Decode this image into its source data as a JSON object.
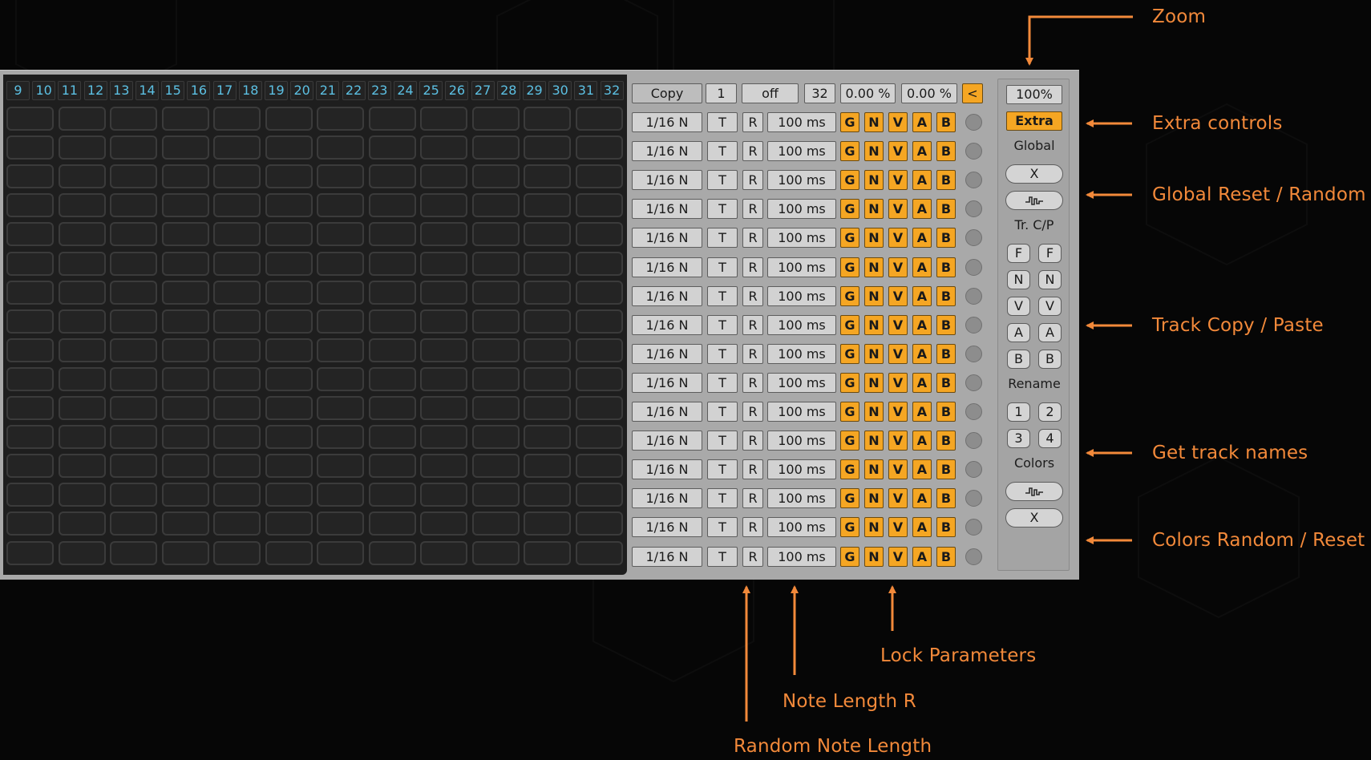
{
  "step_numbers": [
    "9",
    "10",
    "11",
    "12",
    "13",
    "14",
    "15",
    "16",
    "17",
    "18",
    "19",
    "20",
    "21",
    "22",
    "23",
    "24",
    "25",
    "26",
    "27",
    "28",
    "29",
    "30",
    "31",
    "32"
  ],
  "header": {
    "copy_label": "Copy",
    "value_1": "1",
    "off_label": "off",
    "value_32": "32",
    "percent_a": "0.00 %",
    "percent_b": "0.00 %",
    "collapse_label": "<"
  },
  "tracks": [
    {
      "note_length": "1/16 N",
      "t": "T",
      "r": "R",
      "time": "100 ms",
      "locks": [
        "G",
        "N",
        "V",
        "A",
        "B"
      ]
    },
    {
      "note_length": "1/16 N",
      "t": "T",
      "r": "R",
      "time": "100 ms",
      "locks": [
        "G",
        "N",
        "V",
        "A",
        "B"
      ]
    },
    {
      "note_length": "1/16 N",
      "t": "T",
      "r": "R",
      "time": "100 ms",
      "locks": [
        "G",
        "N",
        "V",
        "A",
        "B"
      ]
    },
    {
      "note_length": "1/16 N",
      "t": "T",
      "r": "R",
      "time": "100 ms",
      "locks": [
        "G",
        "N",
        "V",
        "A",
        "B"
      ]
    },
    {
      "note_length": "1/16 N",
      "t": "T",
      "r": "R",
      "time": "100 ms",
      "locks": [
        "G",
        "N",
        "V",
        "A",
        "B"
      ]
    },
    {
      "note_length": "1/16 N",
      "t": "T",
      "r": "R",
      "time": "100 ms",
      "locks": [
        "G",
        "N",
        "V",
        "A",
        "B"
      ]
    },
    {
      "note_length": "1/16 N",
      "t": "T",
      "r": "R",
      "time": "100 ms",
      "locks": [
        "G",
        "N",
        "V",
        "A",
        "B"
      ]
    },
    {
      "note_length": "1/16 N",
      "t": "T",
      "r": "R",
      "time": "100 ms",
      "locks": [
        "G",
        "N",
        "V",
        "A",
        "B"
      ]
    },
    {
      "note_length": "1/16 N",
      "t": "T",
      "r": "R",
      "time": "100 ms",
      "locks": [
        "G",
        "N",
        "V",
        "A",
        "B"
      ]
    },
    {
      "note_length": "1/16 N",
      "t": "T",
      "r": "R",
      "time": "100 ms",
      "locks": [
        "G",
        "N",
        "V",
        "A",
        "B"
      ]
    },
    {
      "note_length": "1/16 N",
      "t": "T",
      "r": "R",
      "time": "100 ms",
      "locks": [
        "G",
        "N",
        "V",
        "A",
        "B"
      ]
    },
    {
      "note_length": "1/16 N",
      "t": "T",
      "r": "R",
      "time": "100 ms",
      "locks": [
        "G",
        "N",
        "V",
        "A",
        "B"
      ]
    },
    {
      "note_length": "1/16 N",
      "t": "T",
      "r": "R",
      "time": "100 ms",
      "locks": [
        "G",
        "N",
        "V",
        "A",
        "B"
      ]
    },
    {
      "note_length": "1/16 N",
      "t": "T",
      "r": "R",
      "time": "100 ms",
      "locks": [
        "G",
        "N",
        "V",
        "A",
        "B"
      ]
    },
    {
      "note_length": "1/16 N",
      "t": "T",
      "r": "R",
      "time": "100 ms",
      "locks": [
        "G",
        "N",
        "V",
        "A",
        "B"
      ]
    },
    {
      "note_length": "1/16 N",
      "t": "T",
      "r": "R",
      "time": "100 ms",
      "locks": [
        "G",
        "N",
        "V",
        "A",
        "B"
      ]
    }
  ],
  "right_panel": {
    "zoom": "100%",
    "extra": "Extra",
    "global_label": "Global",
    "reset_symbol": "X",
    "random_icon": "random-wave-icon",
    "track_cp_label": "Tr. C/P",
    "copy_paste_pairs": [
      [
        "F",
        "F"
      ],
      [
        "N",
        "N"
      ],
      [
        "V",
        "V"
      ],
      [
        "A",
        "A"
      ],
      [
        "B",
        "B"
      ]
    ],
    "rename_label": "Rename",
    "rename_buttons": [
      [
        "1",
        "2"
      ],
      [
        "3",
        "4"
      ]
    ],
    "colors_label": "Colors",
    "colors_random_icon": "random-wave-icon",
    "colors_reset_symbol": "X"
  },
  "annotations": {
    "zoom": "Zoom",
    "extra_controls": "Extra controls",
    "global_reset_random": "Global Reset / Random",
    "track_copy_paste": "Track Copy / Paste",
    "get_track_names": "Get track names",
    "colors_random_reset": "Colors Random / Reset",
    "lock_parameters": "Lock Parameters",
    "note_length_r": "Note Length R",
    "random_note_length": "Random Note Length"
  },
  "colors": {
    "accent_orange": "#f5a623",
    "annotation_orange": "#f2893a",
    "step_number_blue": "#5cc0e3",
    "panel_grey": "#a9a9a9",
    "grid_dark": "#1e1e1e"
  }
}
